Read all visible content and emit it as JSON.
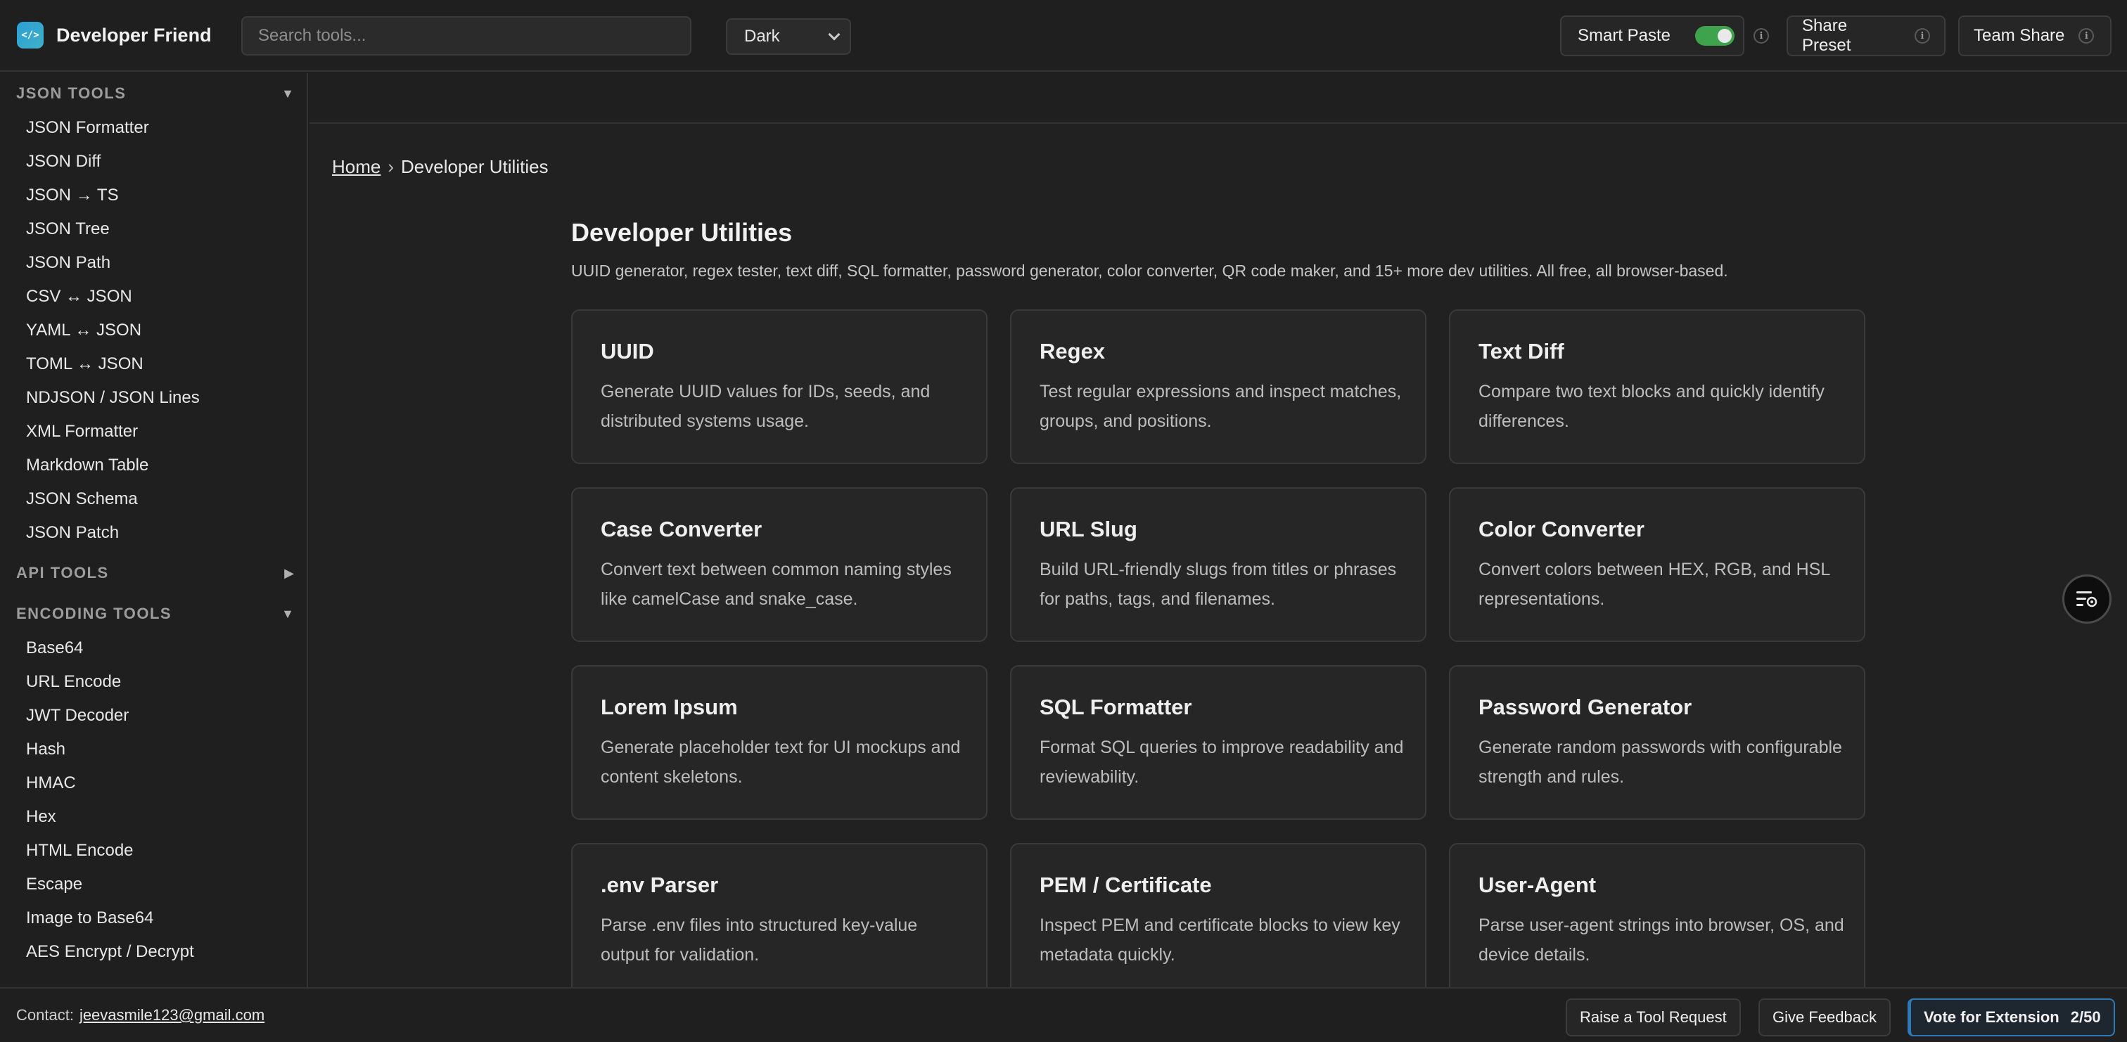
{
  "app": {
    "title": "Developer Friend",
    "logo_text": "</>"
  },
  "header": {
    "search_placeholder": "Search tools...",
    "theme_value": "Dark",
    "smart_paste_label": "Smart Paste",
    "share_preset_label": "Share Preset",
    "team_share_label": "Team Share",
    "info_glyph": "i"
  },
  "sidebar": {
    "sections": [
      {
        "title": "JSON TOOLS",
        "expanded": true,
        "arrow": "▼",
        "items": [
          "JSON Formatter",
          "JSON Diff",
          "JSON → TS",
          "JSON Tree",
          "JSON Path",
          "CSV ↔ JSON",
          "YAML ↔ JSON",
          "TOML ↔ JSON",
          "NDJSON / JSON Lines",
          "XML Formatter",
          "Markdown Table",
          "JSON Schema",
          "JSON Patch"
        ]
      },
      {
        "title": "API TOOLS",
        "expanded": false,
        "arrow": "▶",
        "items": []
      },
      {
        "title": "ENCODING TOOLS",
        "expanded": true,
        "arrow": "▼",
        "items": [
          "Base64",
          "URL Encode",
          "JWT Decoder",
          "Hash",
          "HMAC",
          "Hex",
          "HTML Encode",
          "Escape",
          "Image to Base64",
          "AES Encrypt / Decrypt"
        ]
      }
    ]
  },
  "main": {
    "breadcrumb": {
      "home": "Home",
      "separator": "›",
      "current": "Developer Utilities"
    },
    "title": "Developer Utilities",
    "subtitle": "UUID generator, regex tester, text diff, SQL formatter, password generator, color converter, QR code maker, and 15+ more dev utilities. All free, all browser-based.",
    "cards": [
      {
        "title": "UUID",
        "desc": "Generate UUID values for IDs, seeds, and distributed systems usage."
      },
      {
        "title": "Regex",
        "desc": "Test regular expressions and inspect matches, groups, and positions."
      },
      {
        "title": "Text Diff",
        "desc": "Compare two text blocks and quickly identify differences."
      },
      {
        "title": "Case Converter",
        "desc": "Convert text between common naming styles like camelCase and snake_case."
      },
      {
        "title": "URL Slug",
        "desc": "Build URL-friendly slugs from titles or phrases for paths, tags, and filenames."
      },
      {
        "title": "Color Converter",
        "desc": "Convert colors between HEX, RGB, and HSL representations."
      },
      {
        "title": "Lorem Ipsum",
        "desc": "Generate placeholder text for UI mockups and content skeletons."
      },
      {
        "title": "SQL Formatter",
        "desc": "Format SQL queries to improve readability and reviewability."
      },
      {
        "title": "Password Generator",
        "desc": "Generate random passwords with configurable strength and rules."
      },
      {
        "title": ".env Parser",
        "desc": "Parse .env files into structured key-value output for validation."
      },
      {
        "title": "PEM / Certificate",
        "desc": "Inspect PEM and certificate blocks to view key metadata quickly."
      },
      {
        "title": "User-Agent",
        "desc": "Parse user-agent strings into browser, OS, and device details."
      }
    ]
  },
  "footer": {
    "contact_label": "Contact:",
    "contact_email": "jeevasmile123@gmail.com",
    "tool_request_label": "Raise a Tool Request",
    "feedback_label": "Give Feedback",
    "vote_label": "Vote for Extension",
    "vote_count": "2/50"
  },
  "colors": {
    "background": "#1f1f1f",
    "card": "#262626",
    "toggle_on": "#3fa34d",
    "accent": "#2f79b8"
  }
}
